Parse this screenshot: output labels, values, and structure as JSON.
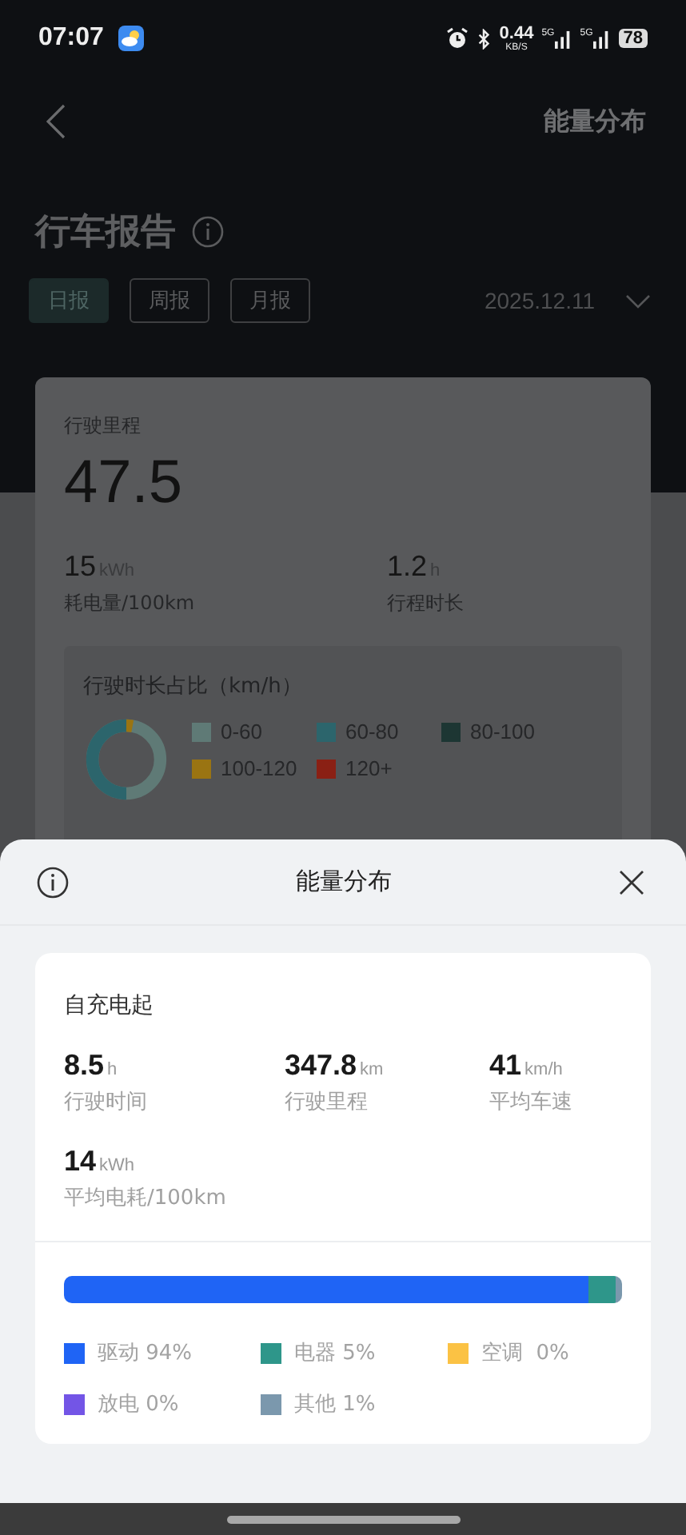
{
  "status_bar": {
    "time": "07:07",
    "net_speed": "0.44",
    "net_unit": "KB/S",
    "sim1": "5G",
    "sim2": "5G",
    "battery": "78"
  },
  "header": {
    "title": "能量分布"
  },
  "report": {
    "title": "行车报告",
    "tabs": [
      {
        "label": "日报",
        "selected": true
      },
      {
        "label": "周报",
        "selected": false
      },
      {
        "label": "月报",
        "selected": false
      }
    ],
    "date": "2025.12.11",
    "mileage": {
      "label": "行驶里程",
      "value": "47.5"
    },
    "stats": [
      {
        "value": "15",
        "unit": "kWh",
        "label": "耗电量/100km"
      },
      {
        "value": "1.2",
        "unit": "h",
        "label": "行程时长"
      }
    ],
    "speed_share": {
      "title": "行驶时长占比（km/h）",
      "legend": [
        {
          "label": "0-60",
          "color": "#5f7a76"
        },
        {
          "label": "60-80",
          "color": "#2c656c"
        },
        {
          "label": "80-100",
          "color": "#1d3633"
        },
        {
          "label": "100-120",
          "color": "#9a7412"
        },
        {
          "label": "120+",
          "color": "#8a2014"
        }
      ]
    }
  },
  "sheet": {
    "title": "能量分布",
    "section": "自充电起",
    "stats": [
      {
        "value": "8.5",
        "unit": "h",
        "label": "行驶时间"
      },
      {
        "value": "347.8",
        "unit": "km",
        "label": "行驶里程"
      },
      {
        "value": "41",
        "unit": "km/h",
        "label": "平均车速"
      },
      {
        "value": "14",
        "unit": "kWh",
        "label": "平均电耗/100km"
      }
    ],
    "energy": [
      {
        "label": "驱动 94%",
        "color": "#1f64f5",
        "level": 0.94
      },
      {
        "label": "电器 5%",
        "color": "#2e968a",
        "level": 0.05
      },
      {
        "label": "空调  0%",
        "color": "#fbc244",
        "level": 0
      },
      {
        "label": "放电 0%",
        "color": "#7355e6",
        "level": 0
      },
      {
        "label": "其他 1%",
        "color": "#7b98ad",
        "level": 0.01
      }
    ]
  }
}
